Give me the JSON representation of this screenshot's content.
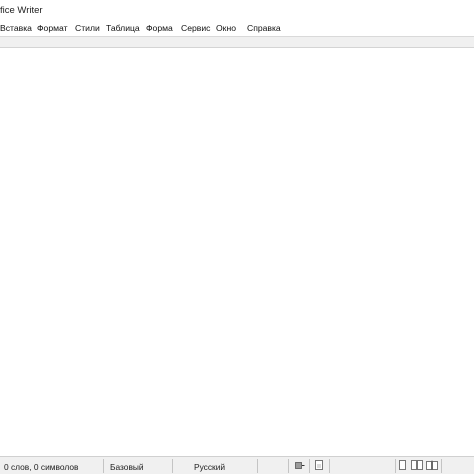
{
  "window": {
    "title": "fice Writer"
  },
  "menubar": {
    "items": [
      {
        "label": "Вставка"
      },
      {
        "label": "Формат"
      },
      {
        "label": "Стили"
      },
      {
        "label": "Таблица"
      },
      {
        "label": "Форма"
      },
      {
        "label": "Сервис"
      },
      {
        "label": "Окно"
      },
      {
        "label": "Справка"
      }
    ]
  },
  "statusbar": {
    "word_count": "0 слов, 0 символов",
    "page_style": "Базовый",
    "language": "Русский",
    "icons": [
      "selection-mode-icon",
      "document-modified-icon",
      "single-page-view-icon",
      "multi-page-view-icon",
      "book-view-icon"
    ]
  },
  "colors": {
    "background": "#ffffff",
    "statusbar_background": "#f0f0f0",
    "toolbar_strip": "#f0f0f0",
    "text": "#111111"
  }
}
